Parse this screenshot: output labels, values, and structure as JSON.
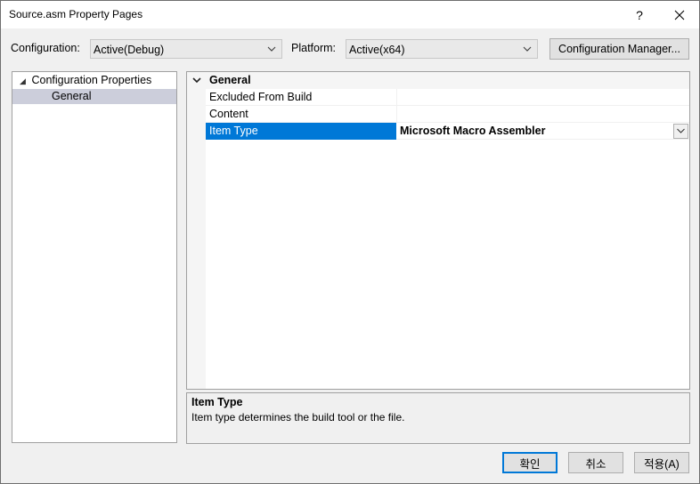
{
  "window": {
    "title": "Source.asm Property Pages",
    "help": "?",
    "close": "✕"
  },
  "config": {
    "configuration_label": "Configuration:",
    "configuration_value": "Active(Debug)",
    "platform_label": "Platform:",
    "platform_value": "Active(x64)",
    "manager_button": "Configuration Manager..."
  },
  "tree": {
    "root": "Configuration Properties",
    "selected": "General"
  },
  "grid": {
    "category": "General",
    "rows": [
      {
        "name": "Excluded From Build",
        "value": ""
      },
      {
        "name": "Content",
        "value": ""
      },
      {
        "name": "Item Type",
        "value": "Microsoft Macro Assembler"
      }
    ]
  },
  "description": {
    "title": "Item Type",
    "text": "Item type determines the build tool or the file."
  },
  "buttons": {
    "ok": "확인",
    "cancel": "취소",
    "apply": "적용(A)"
  },
  "colors": {
    "accent": "#0078d7",
    "tree_selection": "#cccedb"
  }
}
